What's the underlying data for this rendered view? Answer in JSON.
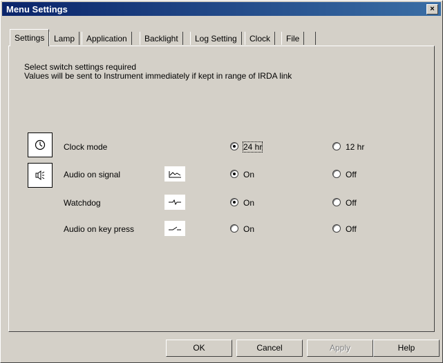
{
  "window": {
    "title": "Menu Settings",
    "close_glyph": "×"
  },
  "tabs": [
    {
      "label": "Settings",
      "active": true
    },
    {
      "label": "Lamp"
    },
    {
      "label": "Application"
    },
    {
      "label": "Backlight"
    },
    {
      "label": "Log Setting"
    },
    {
      "label": "Clock"
    },
    {
      "label": "File"
    }
  ],
  "instructions": [
    "Select switch settings required",
    "Values will be sent to Instrument immediately if kept in range of IRDA link"
  ],
  "settings": [
    {
      "label": "Clock mode",
      "option_a": "24 hr",
      "option_b": "12 hr",
      "selected": "a"
    },
    {
      "label": "Audio on signal",
      "option_a": "On",
      "option_b": "Off",
      "selected": "a"
    },
    {
      "label": "Watchdog",
      "option_a": "On",
      "option_b": "Off",
      "selected": "a"
    },
    {
      "label": "Audio on key press",
      "option_a": "On",
      "option_b": "Off",
      "selected": "none"
    }
  ],
  "icons": [
    "clock-icon",
    "speaker-icon",
    "signal-waveform-icon",
    "watchdog-pulse-icon",
    "key-press-switch-icon"
  ],
  "buttons": {
    "ok": "OK",
    "cancel": "Cancel",
    "apply": "Apply",
    "help": "Help"
  }
}
